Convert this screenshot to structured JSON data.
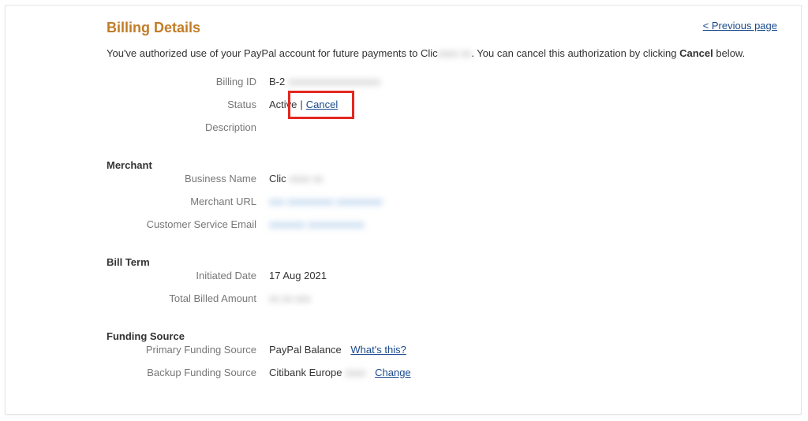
{
  "header": {
    "title": "Billing Details",
    "previous": "< Previous page"
  },
  "intro": {
    "part1": "You've authorized use of your PayPal account for future payments to Clic",
    "merchant_suffix_hidden": "xxxx xx",
    "part2": ". You can cancel this authorization by clicking ",
    "bold": "Cancel",
    "part3": " below."
  },
  "labels": {
    "billing_id": "Billing ID",
    "status": "Status",
    "description": "Description",
    "merchant": "Merchant",
    "business_name": "Business Name",
    "merchant_url": "Merchant URL",
    "cs_email": "Customer Service Email",
    "bill_term": "Bill Term",
    "initiated": "Initiated Date",
    "total_billed": "Total Billed Amount",
    "funding_source": "Funding Source",
    "primary": "Primary Funding Source",
    "backup": "Backup Funding Source"
  },
  "values": {
    "billing_id_prefix": "B-2",
    "billing_id_hidden": "xxxxxxxxxxxxxxxxxx",
    "status_active": "Active",
    "status_sep": " | ",
    "cancel": "Cancel",
    "business_name_prefix": "Clic",
    "business_name_hidden": "xxxx xx",
    "merchant_url_hidden": "xxx xxxxxxxxx xxxxxxxxx",
    "cs_email_hidden": "xxxxxxx xxxxxxxxxxx",
    "initiated": "17 Aug 2021",
    "total_billed_hidden": "xx xx xxx",
    "primary": "PayPal Balance",
    "whats_this": "What's this?",
    "backup_prefix": "Citibank Europe",
    "backup_hidden": "xxxx",
    "change": "Change"
  }
}
